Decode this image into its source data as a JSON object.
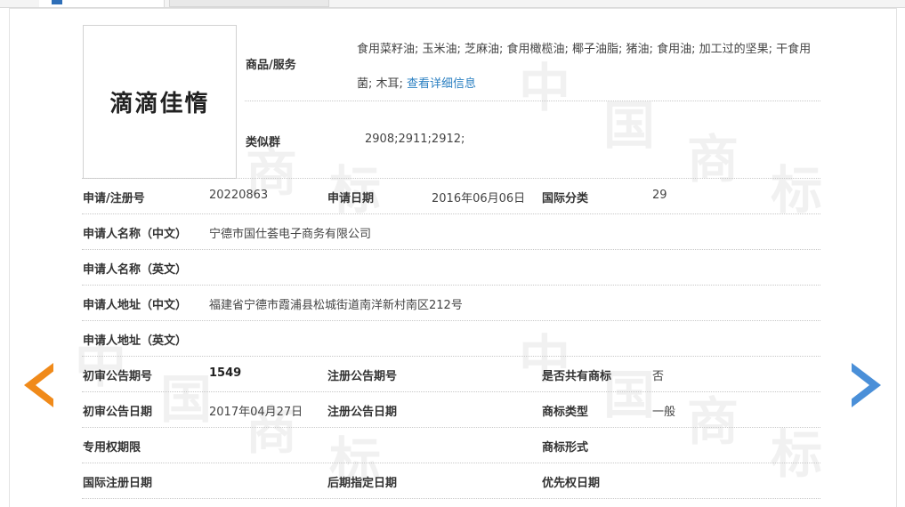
{
  "tabs": [
    {
      "label": ""
    },
    {
      "label": ""
    }
  ],
  "watermark": {
    "chars": [
      "中",
      "国",
      "商",
      "标"
    ]
  },
  "trademark": {
    "logo_text": "滴滴佳惰",
    "goods_label": "商品/服务",
    "goods_text": "食用菜籽油; 玉米油; 芝麻油; 食用橄榄油; 椰子油脂; 猪油; 食用油; 加工过的坚果; 干食用菌; 木耳;",
    "goods_more_link": "查看详细信息",
    "similar_group_label": "类似群",
    "similar_group_value": "2908;2911;2912;"
  },
  "fields": {
    "reg_no_label": "申请/注册号",
    "reg_no_value": "20220863",
    "apply_date_label": "申请日期",
    "apply_date_value": "2016年06月06日",
    "intl_class_label": "国际分类",
    "intl_class_value": "29",
    "applicant_cn_label": "申请人名称（中文）",
    "applicant_cn_value": "宁德市国仕荟电子商务有限公司",
    "applicant_en_label": "申请人名称（英文）",
    "applicant_en_value": "",
    "address_cn_label": "申请人地址（中文）",
    "address_cn_value": "福建省宁德市霞浦县松城街道南洋新村南区212号",
    "address_en_label": "申请人地址（英文）",
    "address_en_value": "",
    "prelim_no_label": "初审公告期号",
    "prelim_no_value": "1549",
    "reg_notice_no_label": "注册公告期号",
    "reg_notice_no_value": "",
    "shared_label": "是否共有商标",
    "shared_value": "否",
    "prelim_date_label": "初审公告日期",
    "prelim_date_value": "2017年04月27日",
    "reg_notice_date_label": "注册公告日期",
    "reg_notice_date_value": "",
    "mark_type_label": "商标类型",
    "mark_type_value": "一般",
    "exclusive_label": "专用权期限",
    "exclusive_value": "",
    "mark_form_label": "商标形式",
    "mark_form_value": "",
    "intl_reg_date_label": "国际注册日期",
    "intl_reg_date_value": "",
    "later_designation_label": "后期指定日期",
    "later_designation_value": "",
    "priority_date_label": "优先权日期",
    "priority_date_value": ""
  },
  "nav": {
    "prev_icon": "chevron-left-icon",
    "next_icon": "chevron-right-icon",
    "prev_color": "#f08a1a",
    "next_color": "#4a8fd8"
  }
}
